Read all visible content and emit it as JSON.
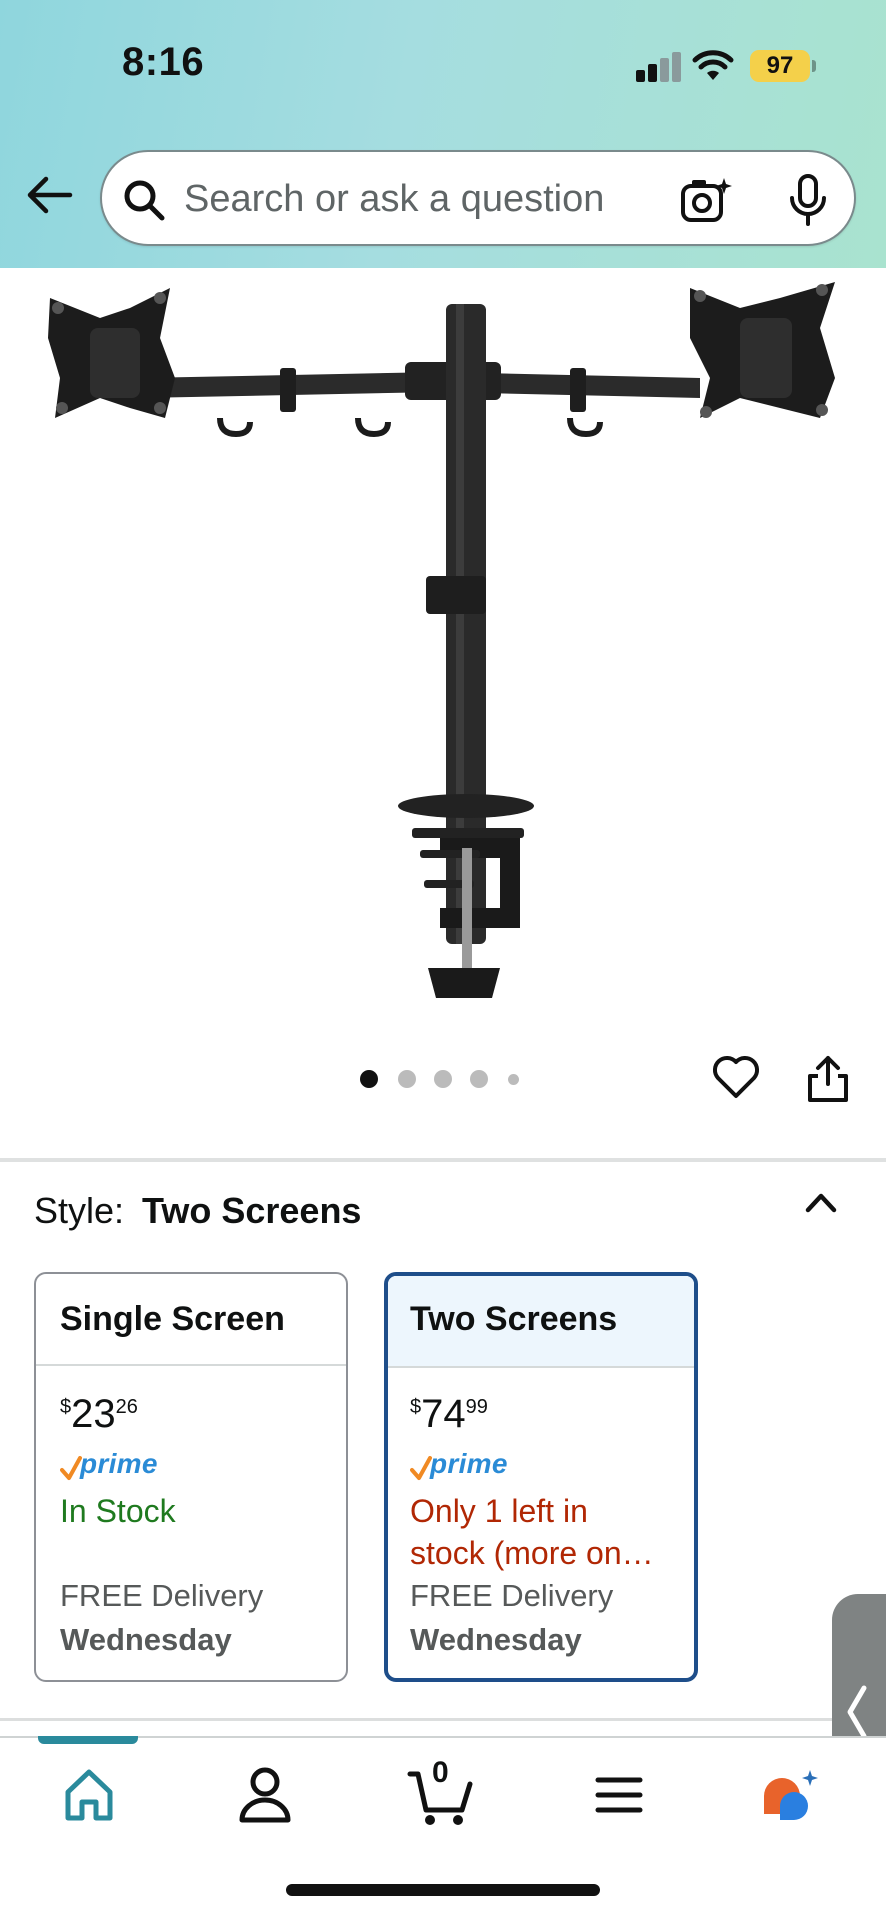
{
  "status_bar": {
    "time": "8:16",
    "battery": "97"
  },
  "search": {
    "placeholder": "Search or ask a question"
  },
  "carousel": {
    "dot_count": 5,
    "active_index": 0
  },
  "style_section": {
    "label": "Style:",
    "selected_value": "Two Screens",
    "options": [
      {
        "name": "Single Screen",
        "price_symbol": "$",
        "price_whole": "23",
        "price_fraction": "26",
        "prime": "prime",
        "stock": "In Stock",
        "delivery_label": "FREE Delivery",
        "delivery_day": "Wednesday",
        "selected": false
      },
      {
        "name": "Two Screens",
        "price_symbol": "$",
        "price_whole": "74",
        "price_fraction": "99",
        "prime": "prime",
        "stock": "Only 1 left in stock (more on…",
        "delivery_label": "FREE Delivery",
        "delivery_day": "Wednesday",
        "selected": true
      }
    ]
  },
  "bottom_nav": {
    "cart_count": "0",
    "active": "home"
  },
  "colors": {
    "prime_blue": "#2a8bd6",
    "in_stock_green": "#1f7a1f",
    "low_stock_red": "#b12704",
    "selected_border": "#1e4e8a",
    "nav_active": "#2a8a9c"
  }
}
